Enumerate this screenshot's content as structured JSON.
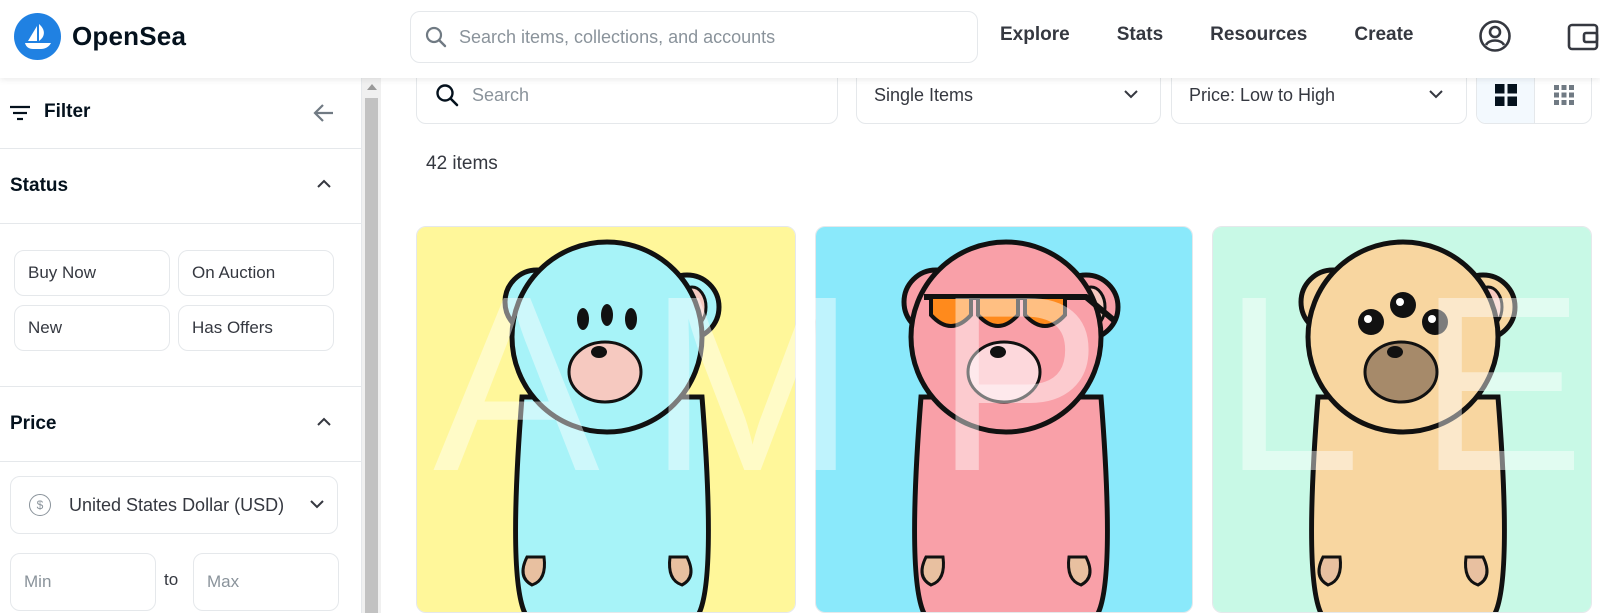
{
  "brand": {
    "name": "OpenSea",
    "accent": "#2081e2"
  },
  "header": {
    "search_placeholder": "Search items, collections, and accounts",
    "nav": [
      "Explore",
      "Stats",
      "Resources",
      "Create"
    ],
    "icons": [
      "account-icon",
      "wallet-icon"
    ]
  },
  "sidebar": {
    "filter_label": "Filter",
    "status": {
      "label": "Status",
      "options": [
        "Buy Now",
        "On Auction",
        "New",
        "Has Offers"
      ]
    },
    "price": {
      "label": "Price",
      "currency": "United States Dollar (USD)",
      "min_placeholder": "Min",
      "to_label": "to",
      "max_placeholder": "Max"
    }
  },
  "main": {
    "search_placeholder": "Search",
    "item_type": "Single Items",
    "sort": "Price: Low to High",
    "item_count": "42 items",
    "watermark": [
      "A",
      "M",
      "P",
      "L",
      "E"
    ],
    "cards": [
      {
        "name": "blue-bear-card",
        "bg": "#fff79a",
        "bear": "#a7f3f8"
      },
      {
        "name": "pink-bear-card",
        "bg": "#8ae9fb",
        "bear": "#f9a0a8"
      },
      {
        "name": "tan-bear-card",
        "bg": "#c8f9e6",
        "bear": "#f8d6a0"
      }
    ]
  }
}
